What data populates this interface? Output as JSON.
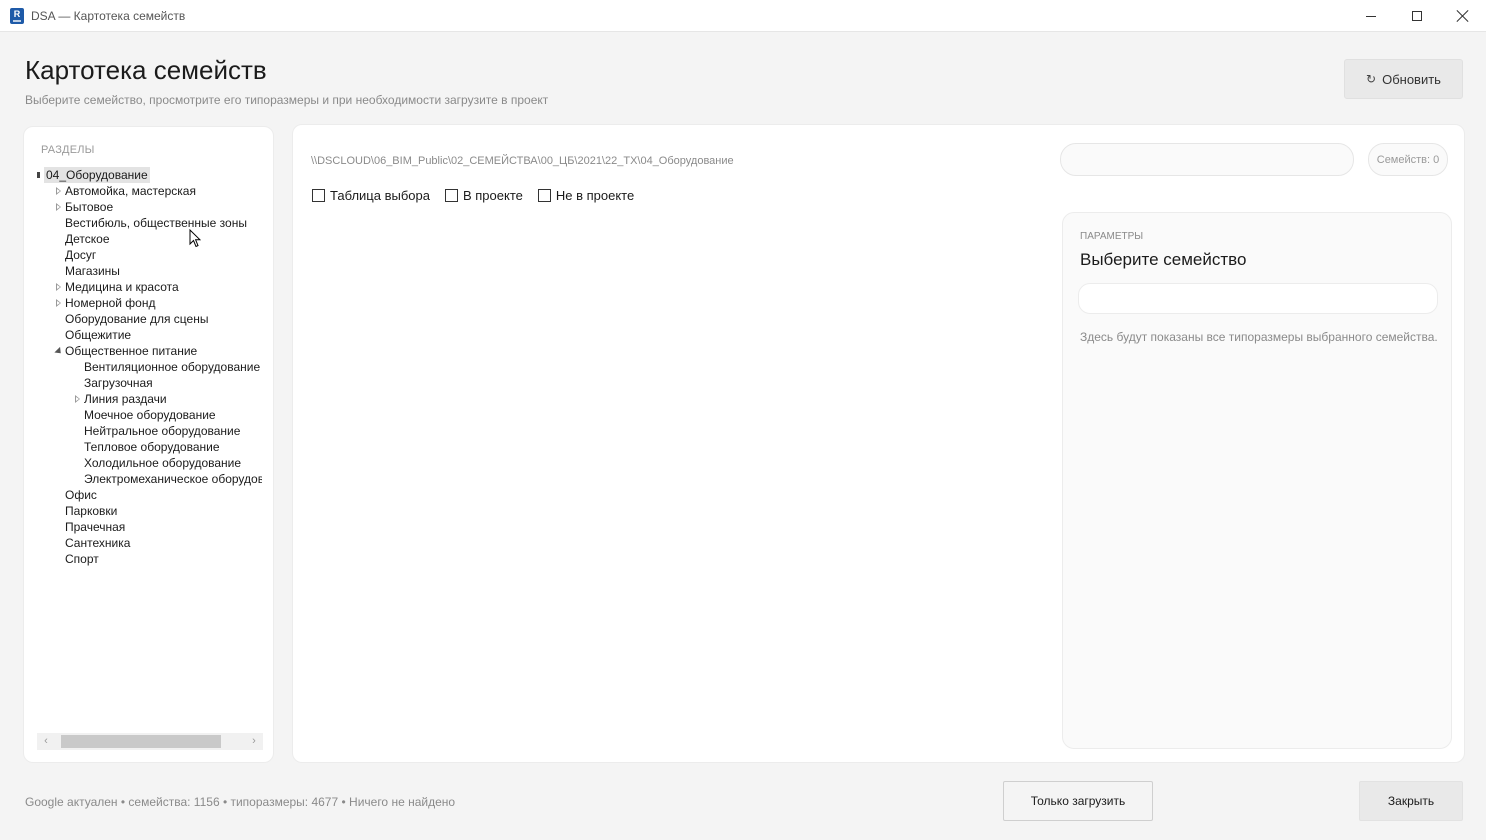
{
  "window": {
    "app_icon_letter": "R",
    "title": "DSA — Картотека семейств"
  },
  "header": {
    "title": "Картотека семейств",
    "subtitle": "Выберите семейство, просмотрите его типоразмеры и при необходимости загрузите в проект",
    "refresh_label": "Обновить",
    "refresh_icon": "↻"
  },
  "sidebar": {
    "section_label": "РАЗДЕЛЫ",
    "tree": [
      {
        "label": "04_Оборудование",
        "level": 0,
        "expander": "filled",
        "selected": true
      },
      {
        "label": "Автомойка, мастерская",
        "level": 1,
        "expander": "collapsed"
      },
      {
        "label": "Бытовое",
        "level": 1,
        "expander": "collapsed"
      },
      {
        "label": "Вестибюль, общественные зоны",
        "level": 1,
        "expander": "none"
      },
      {
        "label": "Детское",
        "level": 1,
        "expander": "none"
      },
      {
        "label": "Досуг",
        "level": 1,
        "expander": "none"
      },
      {
        "label": "Магазины",
        "level": 1,
        "expander": "none"
      },
      {
        "label": "Медицина и красота",
        "level": 1,
        "expander": "collapsed"
      },
      {
        "label": "Номерной фонд",
        "level": 1,
        "expander": "collapsed"
      },
      {
        "label": "Оборудование для сцены",
        "level": 1,
        "expander": "none"
      },
      {
        "label": "Общежитие",
        "level": 1,
        "expander": "none"
      },
      {
        "label": "Общественное питание",
        "level": 1,
        "expander": "expanded"
      },
      {
        "label": "Вентиляционное оборудование",
        "level": 2,
        "expander": "none"
      },
      {
        "label": "Загрузочная",
        "level": 2,
        "expander": "none"
      },
      {
        "label": "Линия раздачи",
        "level": 2,
        "expander": "collapsed"
      },
      {
        "label": "Моечное оборудование",
        "level": 2,
        "expander": "none"
      },
      {
        "label": "Нейтральное оборудование",
        "level": 2,
        "expander": "none"
      },
      {
        "label": "Тепловое оборудование",
        "level": 2,
        "expander": "none"
      },
      {
        "label": "Холодильное оборудование",
        "level": 2,
        "expander": "none"
      },
      {
        "label": "Электромеханическое оборудование",
        "level": 2,
        "expander": "none"
      },
      {
        "label": "Офис",
        "level": 1,
        "expander": "none"
      },
      {
        "label": "Парковки",
        "level": 1,
        "expander": "none"
      },
      {
        "label": "Прачечная",
        "level": 1,
        "expander": "none"
      },
      {
        "label": "Сантехника",
        "level": 1,
        "expander": "none"
      },
      {
        "label": "Спорт",
        "level": 1,
        "expander": "none"
      }
    ],
    "scroll_left": "‹",
    "scroll_right": "›"
  },
  "main": {
    "path": "\\\\DSCLOUD\\06_BIM_Public\\02_СЕМЕЙСТВА\\00_ЦБ\\2021\\22_TX\\04_Оборудование",
    "search_value": "",
    "count_label": "Семейств: 0",
    "filters": [
      {
        "label": "Таблица выбора",
        "checked": false
      },
      {
        "label": "В проекте",
        "checked": false
      },
      {
        "label": "Не в проекте",
        "checked": false
      }
    ]
  },
  "params": {
    "section_label": "ПАРАМЕТРЫ",
    "title": "Выберите семейство",
    "input_value": "",
    "hint": "Здесь будут показаны все типоразмеры выбранного семейства."
  },
  "footer": {
    "status": "Google актуален  •  семейства: 1156  •  типоразмеры: 4677  •  Ничего не найдено",
    "load_only_label": "Только загрузить",
    "close_label": "Закрыть"
  }
}
